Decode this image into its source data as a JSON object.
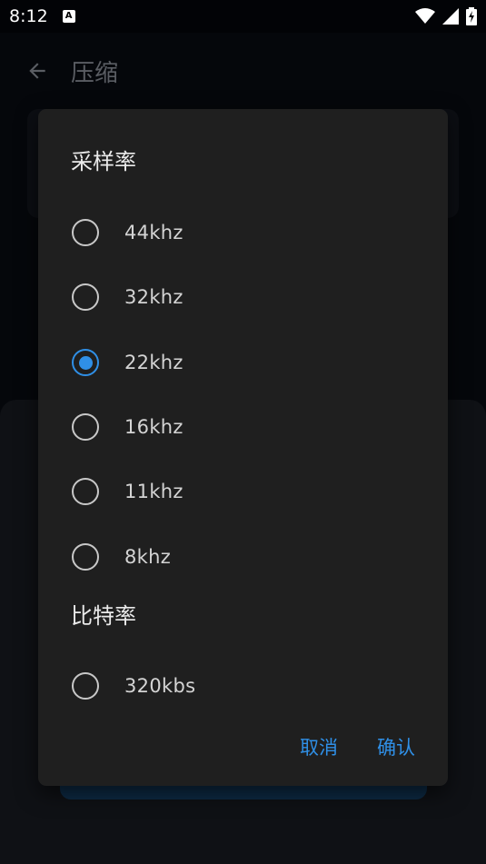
{
  "status_bar": {
    "time": "8:12",
    "notification_glyph": "A",
    "icons": [
      "wifi-icon",
      "signal-icon",
      "battery-charging-icon"
    ]
  },
  "app_bar": {
    "title": "压缩",
    "back_icon": "arrow-back-icon"
  },
  "dialog": {
    "sample_rate_title": "采样率",
    "sample_rates": [
      {
        "label": "44khz",
        "selected": false
      },
      {
        "label": "32khz",
        "selected": false
      },
      {
        "label": "22khz",
        "selected": true
      },
      {
        "label": "16khz",
        "selected": false
      },
      {
        "label": "11khz",
        "selected": false
      },
      {
        "label": "8khz",
        "selected": false
      }
    ],
    "bitrate_title": "比特率",
    "bitrates": [
      {
        "label": "320kbs",
        "selected": false
      }
    ],
    "cancel_label": "取消",
    "confirm_label": "确认"
  },
  "colors": {
    "accent": "#2f8fe6",
    "dialog_bg": "#1f1f1f",
    "scrim_bg": "#05070b"
  }
}
